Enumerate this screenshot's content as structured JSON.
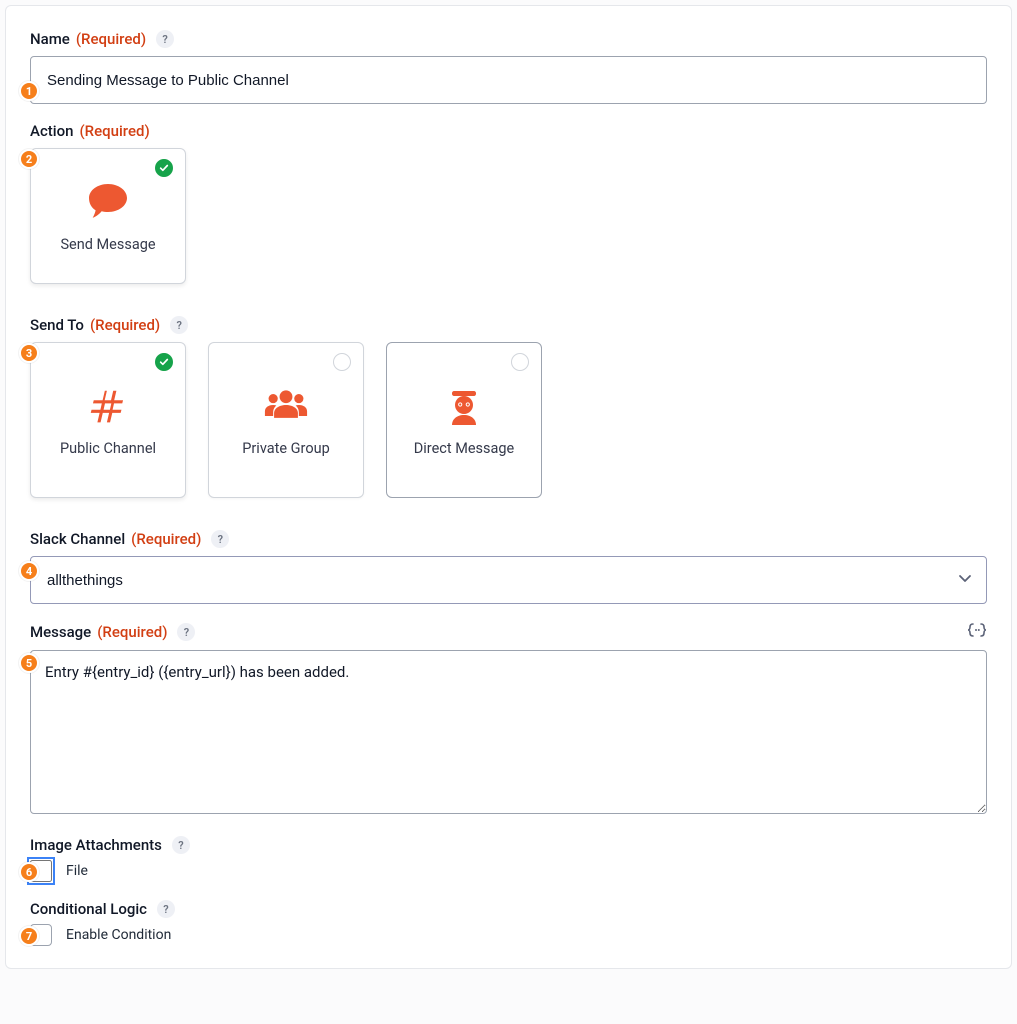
{
  "badges": [
    "1",
    "2",
    "3",
    "4",
    "5",
    "6",
    "7"
  ],
  "labels": {
    "required": "(Required)",
    "name": "Name",
    "action": "Action",
    "send_to": "Send To",
    "channel": "Slack Channel",
    "message": "Message",
    "attachments": "Image Attachments",
    "logic": "Conditional Logic"
  },
  "name_value": "Sending Message to Public Channel",
  "action_tile": {
    "label": "Send Message",
    "selected": true
  },
  "send_to_tiles": [
    {
      "label": "Public Channel",
      "selected": true,
      "icon": "hash"
    },
    {
      "label": "Private Group",
      "selected": false,
      "icon": "group"
    },
    {
      "label": "Direct Message",
      "selected": false,
      "icon": "agent"
    }
  ],
  "channel_value": "allthethings",
  "message_value": "Entry #{entry_id} ({entry_url}) has been added.",
  "attachments_option": "File",
  "logic_option": "Enable Condition"
}
